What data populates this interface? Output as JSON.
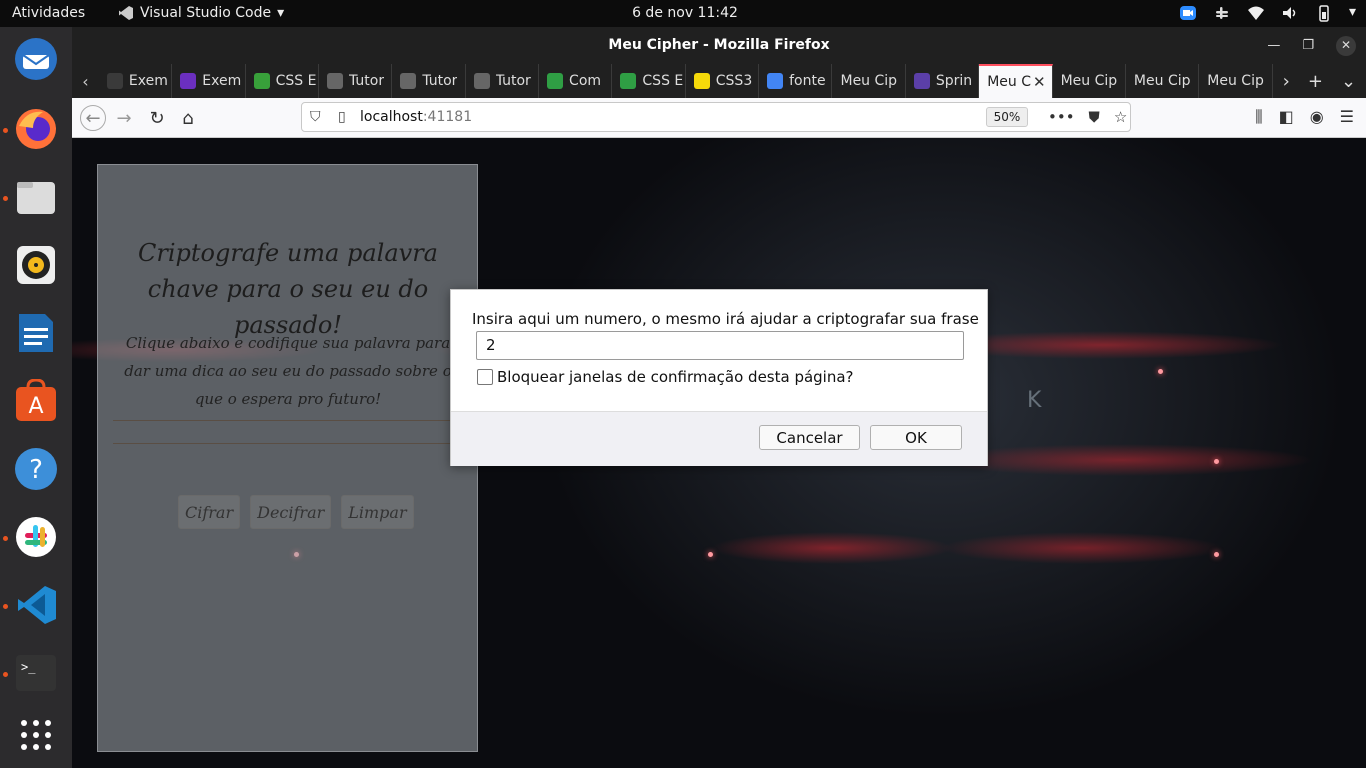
{
  "topbar": {
    "activities": "Atividades",
    "app_name": "Visual Studio Code",
    "clock": "6 de nov  11:42"
  },
  "dock": {
    "items": [
      "thunderbird-icon",
      "firefox-icon",
      "files-icon",
      "rhythmbox-icon",
      "writer-icon",
      "software-icon",
      "help-icon",
      "slack-icon",
      "vscode-icon",
      "terminal-icon",
      "apps-grid-icon"
    ]
  },
  "window": {
    "title": "Meu Cipher - Mozilla Firefox"
  },
  "tabs": [
    {
      "label": "Exem",
      "color": "#3a3a3a"
    },
    {
      "label": "Exem",
      "color": "#6b2fbf"
    },
    {
      "label": "CSS E",
      "color": "#38a03a"
    },
    {
      "label": "Tutor",
      "color": "#666"
    },
    {
      "label": "Tutor",
      "color": "#666"
    },
    {
      "label": "Tutor",
      "color": "#666"
    },
    {
      "label": "Com",
      "color": "#2f9e44"
    },
    {
      "label": "CSS E",
      "color": "#2f9e44"
    },
    {
      "label": "CSS3",
      "color": "#f5d90a"
    },
    {
      "label": "fonte",
      "color": "#4285f4"
    },
    {
      "label": "Meu Cip",
      "color": ""
    },
    {
      "label": "Sprin",
      "color": "#5b3fa8"
    },
    {
      "label": "Meu C",
      "color": "",
      "active": true
    },
    {
      "label": "Meu Cip",
      "color": ""
    },
    {
      "label": "Meu Cip",
      "color": ""
    },
    {
      "label": "Meu Cip",
      "color": ""
    }
  ],
  "urlbar": {
    "host": "localhost",
    "port": ":41181",
    "zoom": "50%"
  },
  "page": {
    "heading": "Criptografe uma palavra chave para o seu eu do passado!",
    "description": "Clique abaixo e codifique sua palavra para dar uma dica ao seu eu do passado sobre o que o espera pro futuro!",
    "buttons": {
      "encrypt": "Cifrar",
      "decrypt": "Decifrar",
      "clear": "Limpar"
    },
    "overlay_letter": "K"
  },
  "dialog": {
    "message": "Insira aqui um numero, o mesmo irá ajudar a criptografar sua frase",
    "input_value": "2",
    "checkbox_label": "Bloquear janelas de confirmação desta página?",
    "cancel": "Cancelar",
    "ok": "OK"
  },
  "colors": {
    "active_tab_accent": "#ff4f5e",
    "ubuntu_orange": "#e95420"
  }
}
